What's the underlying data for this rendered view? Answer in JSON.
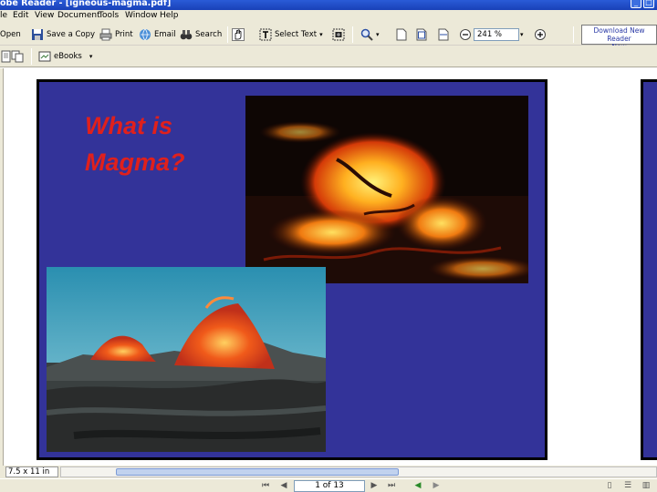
{
  "window": {
    "title": "obe Reader - [igneous-magma.pdf]"
  },
  "menu": {
    "items": [
      "le",
      "Edit",
      "View",
      "Document",
      "Tools",
      "Window",
      "Help"
    ]
  },
  "toolbar": {
    "open_label": "Open",
    "save_copy_label": "Save a Copy",
    "print_label": "Print",
    "email_label": "Email",
    "search_label": "Search",
    "select_text_label": "Select Text",
    "zoom_value": "241 %",
    "ebooks_label": "eBooks",
    "download_line1": "Download New Reader",
    "download_line2": "Now"
  },
  "slide": {
    "title_line1": "What is",
    "title_line2": "Magma?"
  },
  "status": {
    "page_size": "7.5 x 11 in",
    "page_indicator": "1 of 13"
  },
  "colors": {
    "slide_background": "#333399",
    "slide_title": "#e0201c",
    "chrome": "#ece9d8"
  }
}
